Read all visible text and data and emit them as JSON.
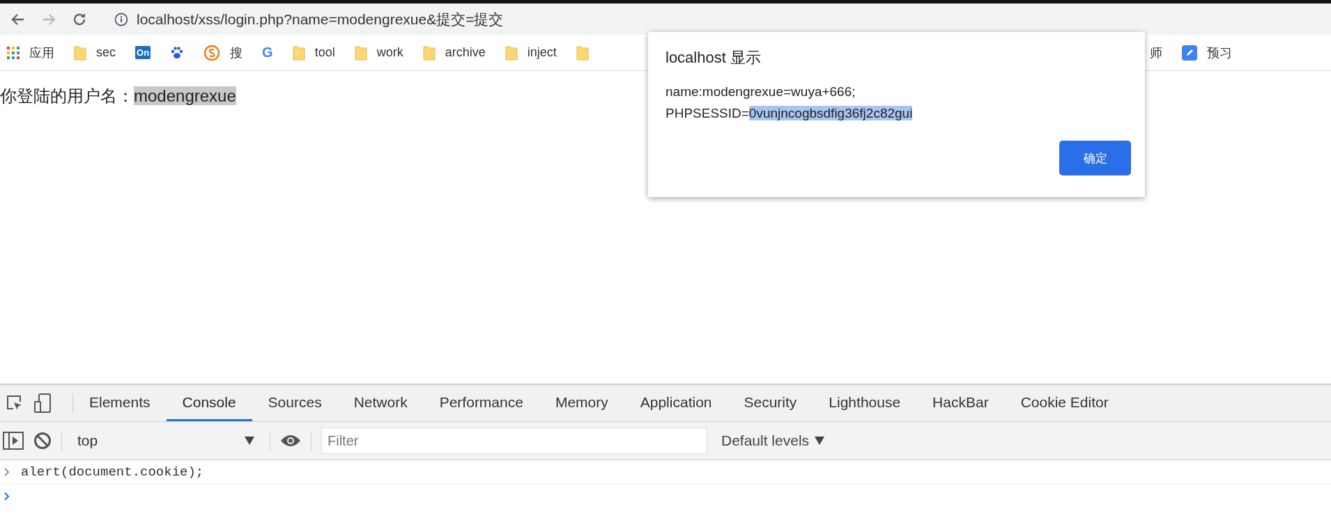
{
  "browser": {
    "nav": [
      {
        "kind": "back",
        "disabled": false
      },
      {
        "kind": "forward",
        "disabled": true
      },
      {
        "kind": "reload",
        "disabled": false
      }
    ],
    "url": "localhost/xss/login.php?name=modengrexue&提交=提交"
  },
  "bookmarks": [
    {
      "kind": "apps",
      "label": "应用"
    },
    {
      "kind": "folder",
      "label": "sec"
    },
    {
      "kind": "tile",
      "label": "On"
    },
    {
      "kind": "paw"
    },
    {
      "kind": "ring",
      "label": "搜"
    },
    {
      "kind": "glyph",
      "label": "G"
    },
    {
      "kind": "folder",
      "label": "tool"
    },
    {
      "kind": "folder",
      "label": "work"
    },
    {
      "kind": "folder",
      "label": "archive"
    },
    {
      "kind": "folder",
      "label": "inject"
    },
    {
      "kind": "folder"
    },
    {
      "kind": "text",
      "label": "师"
    },
    {
      "kind": "pencil",
      "label": "预习"
    }
  ],
  "page": {
    "label": "你登陆的用户名：",
    "value": "modengrexue",
    "highlighted": true
  },
  "dialog": {
    "title": "localhost 显示",
    "lines": [
      {
        "text": "name:modengrexue=wuya+666;"
      },
      {
        "text": "PHPSESSID=",
        "selected_text": "0vunjncogbsdfig36fj2c82gui"
      }
    ],
    "button": "确定"
  },
  "devtools": {
    "tabs": [
      {
        "label": "Elements",
        "selected": false
      },
      {
        "label": "Console",
        "selected": true
      },
      {
        "label": "Sources",
        "selected": false
      },
      {
        "label": "Network",
        "selected": false
      },
      {
        "label": "Performance",
        "selected": false
      },
      {
        "label": "Memory",
        "selected": false
      },
      {
        "label": "Application",
        "selected": false
      },
      {
        "label": "Security",
        "selected": false
      },
      {
        "label": "Lighthouse",
        "selected": false
      },
      {
        "label": "HackBar",
        "selected": false
      },
      {
        "label": "Cookie Editor",
        "selected": false
      }
    ],
    "context": "top",
    "filter": {
      "placeholder": "Filter"
    },
    "levels": "Default levels",
    "console": [
      {
        "kind": "input",
        "text": "alert(document.cookie);"
      },
      {
        "kind": "prompt"
      }
    ]
  }
}
